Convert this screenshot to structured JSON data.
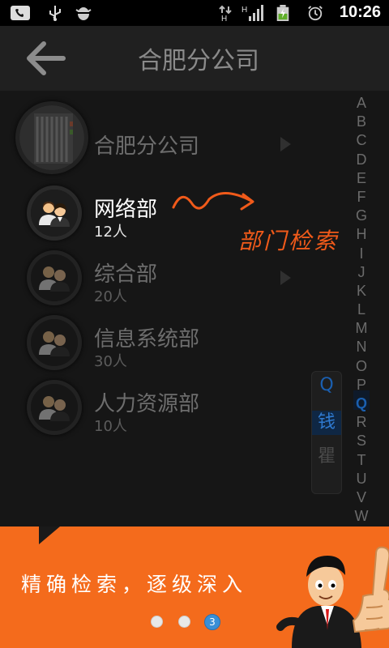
{
  "status_bar": {
    "time": "10:26",
    "signal_label": "H",
    "icons": [
      "phone-icon",
      "usb-icon",
      "android-debug-icon",
      "data-transfer-icon",
      "signal-icon",
      "battery-icon",
      "alarm-icon"
    ]
  },
  "header": {
    "title": "合肥分公司",
    "back_icon": "back-arrow-icon"
  },
  "list": {
    "items": [
      {
        "label": "合肥分公司",
        "count": "",
        "icon": "company-building-icon"
      },
      {
        "label": "网络部",
        "count": "12人",
        "icon": "group-users-icon"
      },
      {
        "label": "综合部",
        "count": "20人",
        "icon": "group-users-icon"
      },
      {
        "label": "信息系统部",
        "count": "30人",
        "icon": "group-users-icon"
      },
      {
        "label": "人力资源部",
        "count": "10人",
        "icon": "group-users-icon"
      }
    ]
  },
  "alpha_index": {
    "letters": [
      "A",
      "B",
      "C",
      "D",
      "E",
      "F",
      "G",
      "H",
      "I",
      "J",
      "K",
      "L",
      "M",
      "N",
      "O",
      "P",
      "Q",
      "R",
      "S",
      "T",
      "U",
      "V",
      "W"
    ],
    "selected": "Q"
  },
  "index_popup": {
    "letter": "Q",
    "selected": "钱",
    "next": "瞿"
  },
  "annotation": {
    "text": "部门检索"
  },
  "banner": {
    "text": "精确检索，逐级深入",
    "dots": [
      "",
      "",
      "3"
    ],
    "active_dot": "3"
  },
  "colors": {
    "accent_orange": "#f46b1c",
    "index_blue": "#1a5fb0",
    "background": "#161616"
  }
}
